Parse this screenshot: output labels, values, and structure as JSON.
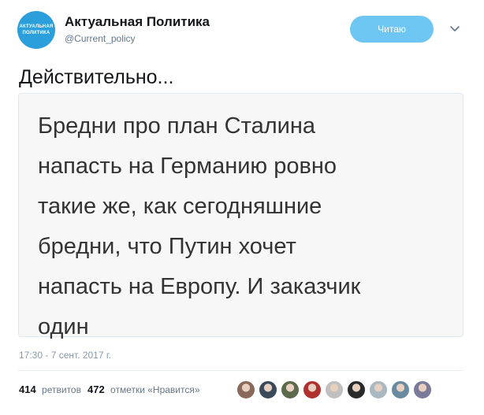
{
  "account": {
    "name": "Актуальная Политика",
    "handle": "@Current_policy",
    "avatar_text_line1": "АКТУАЛЬНАЯ",
    "avatar_text_line2": "ПОЛИТИКА",
    "avatar_color": "#2b9fdc"
  },
  "actions": {
    "follow_label": "Читаю",
    "follow_color": "#6ec7f3",
    "more_icon": "chevron-down-icon"
  },
  "tweet": {
    "text": "Действительно...",
    "quote_lines": [
      "Бредни про план Сталина",
      "напасть на Германию ровно",
      "такие же, как сегодняшние",
      "бредни, что Путин хочет",
      "напасть на Европу. И заказчик",
      "один"
    ],
    "timestamp": "17:30 - 7 сент. 2017 г."
  },
  "stats": {
    "retweets_count": "414",
    "retweets_label": "ретвитов",
    "likes_count": "472",
    "likes_label": "отметки «Нравится»"
  },
  "likers": [
    {
      "color": "#8a6a5a"
    },
    {
      "color": "#3a4a5a"
    },
    {
      "color": "#5a6a4a"
    },
    {
      "color": "#b03030"
    },
    {
      "color": "#c0c0c0"
    },
    {
      "color": "#2a2a2a"
    },
    {
      "color": "#aab8c2"
    },
    {
      "color": "#6a8aa0"
    },
    {
      "color": "#7a7a9a"
    }
  ]
}
